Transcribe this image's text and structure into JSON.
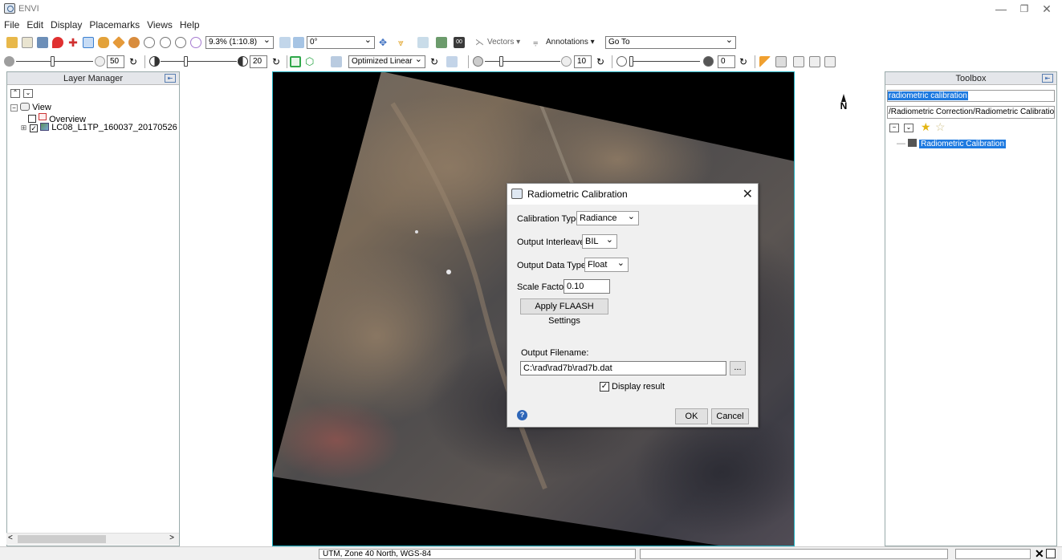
{
  "window": {
    "title": "ENVI",
    "minimize": "—",
    "restore": "❐",
    "close": "✕"
  },
  "menu": [
    "File",
    "Edit",
    "Display",
    "Placemarks",
    "Views",
    "Help"
  ],
  "toolbar1": {
    "zoom_value": "9.3% (1:10.8)",
    "rotation_value": "0°",
    "vectors_label": "Vectors ▾",
    "annotations_label": "Annotations ▾",
    "goto_value": "Go To"
  },
  "toolbar2": {
    "brightness_value": "50",
    "contrast_value": "20",
    "stretch_value": "Optimized Linear",
    "sharpen_value": "10",
    "transparency_value": "0"
  },
  "layer_manager": {
    "title": "Layer Manager",
    "tree": {
      "view": "View",
      "overview": "Overview",
      "layer": "LC08_L1TP_160037_20170526"
    }
  },
  "toolbox": {
    "title": "Toolbox",
    "search_value": "radiometric calibration",
    "path": "/Radiometric Correction/Radiometric Calibration",
    "result": "Radiometric Calibration"
  },
  "north_arrow": "N",
  "dialog": {
    "title": "Radiometric Calibration",
    "calibration_type_label": "Calibration Type",
    "calibration_type_value": "Radiance",
    "output_interleave_label": "Output Interleave",
    "output_interleave_value": "BIL",
    "output_data_type_label": "Output Data Type",
    "output_data_type_value": "Float",
    "scale_factor_label": "Scale Factor",
    "scale_factor_value": "0.10",
    "apply_flaash_label": "Apply FLAASH Settings",
    "output_filename_label": "Output Filename:",
    "output_filename_value": "C:\\rad\\rad7b\\rad7b.dat",
    "browse_label": "...",
    "display_result_label": "Display result",
    "ok_label": "OK",
    "cancel_label": "Cancel"
  },
  "statusbar": {
    "projection": "UTM, Zone 40 North, WGS-84"
  },
  "colors": {
    "selection": "#1e7ae0",
    "viewport_border": "#23b2c4",
    "dialog_bg": "#f0f0f0"
  }
}
